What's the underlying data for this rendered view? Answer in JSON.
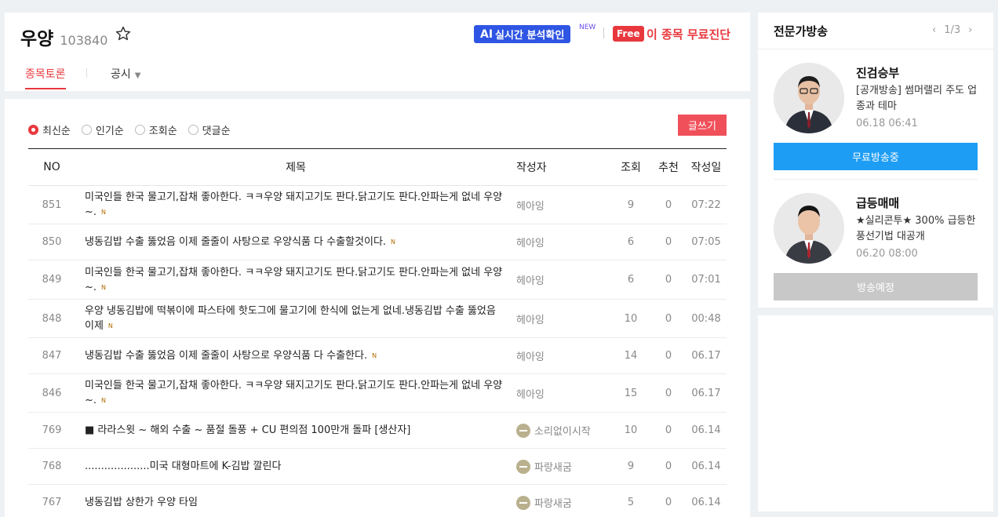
{
  "stock": {
    "name": "우양",
    "code": "103840"
  },
  "header": {
    "ai_prefix": "AI",
    "ai_label": "실시간 분석확인",
    "new_tag": "NEW",
    "free_badge": "Free",
    "free_link": "이 종목 무료진단"
  },
  "tabs": [
    {
      "label": "종목토론"
    },
    {
      "label": "공시"
    }
  ],
  "sort_options": [
    {
      "label": "최신순",
      "selected": true
    },
    {
      "label": "인기순",
      "selected": false
    },
    {
      "label": "조회순",
      "selected": false
    },
    {
      "label": "댓글순",
      "selected": false
    }
  ],
  "write_button": "글쓰기",
  "columns": [
    "NO",
    "제목",
    "작성자",
    "조회",
    "추천",
    "작성일"
  ],
  "posts": [
    {
      "no": "851",
      "title": "미국인들 한국 물고기,잡채 좋아한다. ㅋㅋ우양 돼지고기도 판다.닭고기도 판다.안파는게 없네 우양~.",
      "is_new": true,
      "new_mark": "N",
      "author": "헤아잉",
      "author_icon": false,
      "views": "9",
      "recommends": "0",
      "date": "07:22"
    },
    {
      "no": "850",
      "title": "냉동김밥 수출 뚫었음 이제 줄줄이 사탕으로 우양식품 다 수출할것이다.",
      "is_new": true,
      "new_mark": "N",
      "author": "헤아잉",
      "author_icon": false,
      "views": "6",
      "recommends": "0",
      "date": "07:05"
    },
    {
      "no": "849",
      "title": "미국인들 한국 물고기,잡채 좋아한다. ㅋㅋ우양 돼지고기도 판다.닭고기도 판다.안파는게 없네 우양~.",
      "is_new": true,
      "new_mark": "N",
      "author": "헤아잉",
      "author_icon": false,
      "views": "6",
      "recommends": "0",
      "date": "07:01"
    },
    {
      "no": "848",
      "title": "우양 냉동김밥에 떡볶이에 파스타에 핫도그에 물고기에 한식에 없는게 없네.냉동김밥 수출 뚫었음 이제",
      "is_new": true,
      "new_mark": "N",
      "author": "헤아잉",
      "author_icon": false,
      "views": "10",
      "recommends": "0",
      "date": "00:48"
    },
    {
      "no": "847",
      "title": "냉동김밥 수출 뚫었음 이제 줄줄이 사탕으로 우양식품 다 수출한다.",
      "is_new": true,
      "new_mark": "N",
      "author": "헤아잉",
      "author_icon": false,
      "views": "14",
      "recommends": "0",
      "date": "06.17"
    },
    {
      "no": "846",
      "title": "미국인들 한국 물고기,잡채 좋아한다. ㅋㅋ우양 돼지고기도 판다.닭고기도 판다.안파는게 없네 우양~.",
      "is_new": true,
      "new_mark": "N",
      "author": "헤아잉",
      "author_icon": false,
      "views": "15",
      "recommends": "0",
      "date": "06.17"
    },
    {
      "no": "769",
      "title": "■ 라라스윗 ~ 해외 수출 ~ 품절 돌풍 + CU 편의점 100만개 돌파 [생산자]",
      "is_new": false,
      "new_mark": "",
      "author": "소리없이시작",
      "author_icon": true,
      "views": "10",
      "recommends": "0",
      "date": "06.14"
    },
    {
      "no": "768",
      "title": "....................미국 대형마트에 K-김밥 깔린다",
      "is_new": false,
      "new_mark": "",
      "author": "파랑새굼",
      "author_icon": true,
      "views": "9",
      "recommends": "0",
      "date": "06.14"
    },
    {
      "no": "767",
      "title": "냉동김밥 상한가 우양 타임",
      "is_new": false,
      "new_mark": "",
      "author": "파랑새굼",
      "author_icon": true,
      "views": "5",
      "recommends": "0",
      "date": "06.14"
    }
  ],
  "sidebar": {
    "title": "전문가방송",
    "page": "1/3",
    "experts": [
      {
        "name": "진검승부",
        "desc": "[공개방송] 썸머랠리 주도 업종과 테마",
        "time": "06.18 06:41",
        "button": "무료방송중",
        "live": true
      },
      {
        "name": "급등매매",
        "desc": "★실리콘투★ 300% 급등한 풍선기법 대공개",
        "time": "06.20 08:00",
        "button": "방송예정",
        "live": false
      }
    ]
  },
  "colors": {
    "accent": "#e8383d",
    "ai_blue": "#2f55e4",
    "live_blue": "#1e9df5"
  }
}
